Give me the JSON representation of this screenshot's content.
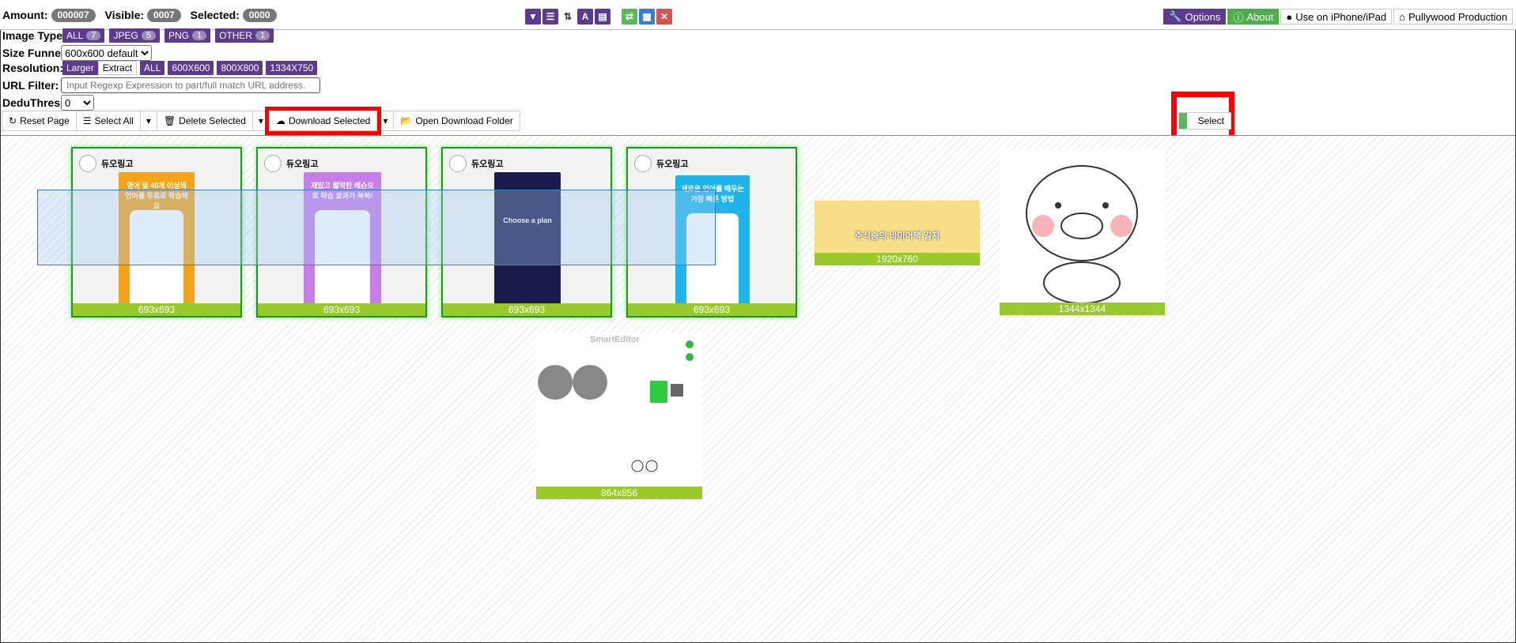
{
  "stats": {
    "amount_label": "Amount:",
    "amount": "000007",
    "visible_label": "Visible:",
    "visible": "0007",
    "selected_label": "Selected:",
    "selected": "0000"
  },
  "header_right": {
    "options": "Options",
    "about": "About",
    "iphone": "Use on iPhone/iPad",
    "production": "Pullywood Production"
  },
  "filters": {
    "image_type_label": "Image Type:",
    "types": [
      {
        "name": "ALL",
        "count": "7"
      },
      {
        "name": "JPEG",
        "count": "5"
      },
      {
        "name": "PNG",
        "count": "1"
      },
      {
        "name": "OTHER",
        "count": "1"
      }
    ],
    "size_funnel_label": "Size Funnel:",
    "size_funnel_value": "600x600 default",
    "resolution_label": "Resolution:",
    "resolution_larger": "Larger",
    "resolution_extract": "Extract",
    "resolutions": [
      "ALL",
      "600X600",
      "800X800",
      "1334X750"
    ],
    "url_filter_label": "URL Filter:",
    "url_filter_placeholder": "Input Regexp Expression to part/full match URL address.",
    "dedu_label": "DeduThres:",
    "dedu_value": "0"
  },
  "actions": {
    "reset": "Reset Page",
    "select_all": "Select All",
    "delete": "Delete Selected",
    "download": "Download Selected",
    "open_folder": "Open Download Folder",
    "select_toggle": "Select"
  },
  "images": [
    {
      "brand": "듀오링고",
      "caption": "영어 및 40개 이상의 언어를 무료로 학습해요",
      "dims": "693x693",
      "color": "#f5a31a"
    },
    {
      "brand": "듀오링고",
      "caption": "재밌고 짧막한 레슨으로 학습 효과가 쑥쑥!",
      "dims": "693x693",
      "color": "#c77ee8"
    },
    {
      "brand": "듀오링고",
      "caption": "Choose a plan",
      "dims": "693x693",
      "color": "#1b1c4a"
    },
    {
      "brand": "듀오링고",
      "caption": "새로운 언어를 배우는 가장 빠른 방법",
      "dims": "693x693",
      "color": "#1fb5ec"
    },
    {
      "caption": "주식숨의 바이어택 일지",
      "dims": "1920x760"
    },
    {
      "dims": "1344x1344"
    },
    {
      "caption": "SmartEditor",
      "dims": "864x856"
    }
  ],
  "colors": {
    "accent_purple": "#5b3a8f",
    "accent_green": "#4cae4c",
    "dim_bar": "#9ac92e",
    "highlight_red": "#ff0000"
  }
}
